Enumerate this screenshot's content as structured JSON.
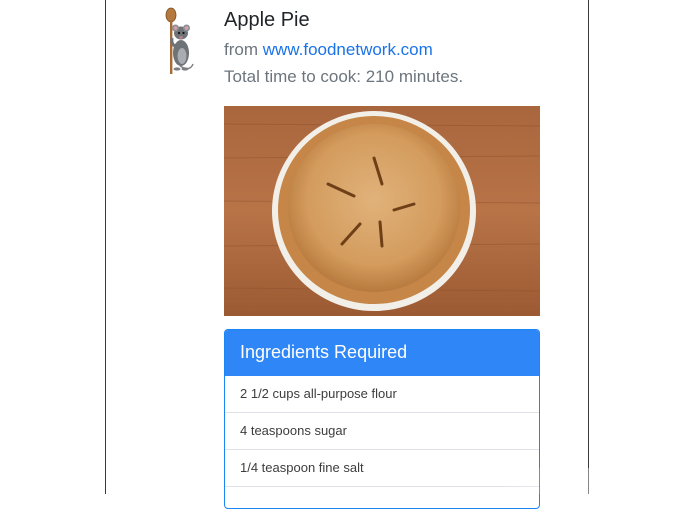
{
  "recipe": {
    "title": "Apple Pie",
    "source_prefix": "from ",
    "source_link": "www.foodnetwork.com",
    "cook_time": "Total time to cook: 210 minutes."
  },
  "icons": {
    "mascot": "rat-chef-with-wooden-spoon"
  },
  "ingredients": {
    "header": "Ingredients Required",
    "items": [
      "2 1/2 cups all-purpose flour",
      "4 teaspoons sugar",
      "1/4 teaspoon fine salt",
      ""
    ]
  },
  "colors": {
    "accent": "#2f86f6",
    "link": "#1a73e8",
    "title": "#212529",
    "muted": "#6c757d"
  }
}
